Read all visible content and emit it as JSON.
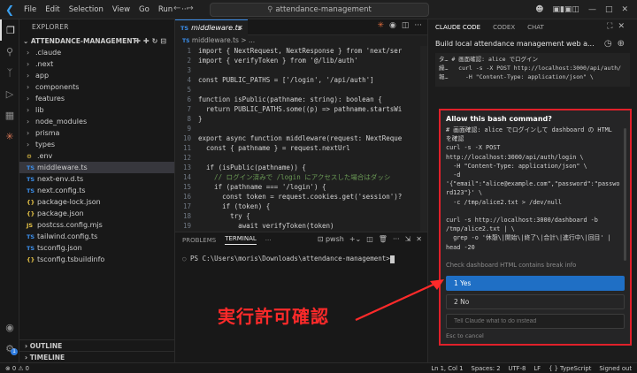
{
  "titlebar": {
    "menus": [
      "File",
      "Edit",
      "Selection",
      "View",
      "Go",
      "Run",
      "···"
    ],
    "search": "attendance-management"
  },
  "sidebar": {
    "header": "EXPLORER",
    "project": "ATTENDANCE-MANAGEMENT",
    "items": [
      {
        "label": ".claude",
        "kind": "folder"
      },
      {
        "label": ".next",
        "kind": "folder"
      },
      {
        "label": "app",
        "kind": "folder"
      },
      {
        "label": "components",
        "kind": "folder"
      },
      {
        "label": "features",
        "kind": "folder"
      },
      {
        "label": "lib",
        "kind": "folder"
      },
      {
        "label": "node_modules",
        "kind": "folder"
      },
      {
        "label": "prisma",
        "kind": "folder"
      },
      {
        "label": "types",
        "kind": "folder"
      },
      {
        "label": ".env",
        "kind": "file",
        "icon": "⚙",
        "color": "#e8c547"
      },
      {
        "label": "middleware.ts",
        "kind": "file",
        "icon": "TS",
        "color": "#3b8eea"
      },
      {
        "label": "next-env.d.ts",
        "kind": "file",
        "icon": "TS",
        "color": "#3b8eea"
      },
      {
        "label": "next.config.ts",
        "kind": "file",
        "icon": "TS",
        "color": "#3b8eea"
      },
      {
        "label": "package-lock.json",
        "kind": "file",
        "icon": "{}",
        "color": "#e8c547"
      },
      {
        "label": "package.json",
        "kind": "file",
        "icon": "{}",
        "color": "#e8c547"
      },
      {
        "label": "postcss.config.mjs",
        "kind": "file",
        "icon": "JS",
        "color": "#e8c547"
      },
      {
        "label": "tailwind.config.ts",
        "kind": "file",
        "icon": "TS",
        "color": "#3b8eea"
      },
      {
        "label": "tsconfig.json",
        "kind": "file",
        "icon": "TS",
        "color": "#3b8eea"
      },
      {
        "label": "tsconfig.tsbuildinfo",
        "kind": "file",
        "icon": "{}",
        "color": "#e8c547"
      }
    ],
    "outline": "OUTLINE",
    "timeline": "TIMELINE"
  },
  "editor": {
    "tab": "middleware.ts",
    "breadcrumb": "middleware.ts > ...",
    "lines": [
      "import { NextRequest, NextResponse } from 'next/ser",
      "import { verifyToken } from '@/lib/auth'",
      "",
      "const PUBLIC_PATHS = ['/login', '/api/auth']",
      "",
      "function isPublic(pathname: string): boolean {",
      "  return PUBLIC_PATHS.some((p) => pathname.startsWi",
      "}",
      "",
      "export async function middleware(request: NextReque",
      "  const { pathname } = request.nextUrl",
      "",
      "  if (isPublic(pathname)) {",
      "    // ログイン済みで /login にアクセスした場合はダッシ",
      "    if (pathname === '/login') {",
      "      const token = request.cookies.get('session')?",
      "      if (token) {",
      "        try {",
      "          await verifyToken(token)",
      "          return NextResponse.redirect(new URL('/da"
    ]
  },
  "panel": {
    "tabs": [
      "PROBLEMS",
      "TERMINAL",
      "···"
    ],
    "shell": "pwsh",
    "prompt": "PS C:\\Users\\moris\\Downloads\\attendance-management>"
  },
  "chat": {
    "tabs": [
      "CLAUDE CODE",
      "CODEX",
      "CHAT"
    ],
    "title": "Build local attendance management web a...",
    "preview": "タ… # 画面確認: alice でログイン\n繰…   curl -s -X POST http://localhost:3000/api/auth/\n報…     -H \"Content-Type: application/json\" \\",
    "dialog": {
      "title": "Allow this bash command?",
      "command": "# 画面確認: alice でログインして dashboard の HTML\nを確認\ncurl -s -X POST\nhttp://localhost:3000/api/auth/login \\\n  -H \"Content-Type: application/json\" \\\n  -d\n'{\"email\":\"alice@example.com\",\"password\":\"passwo\nrd123\"}' \\\n  -c /tmp/alice2.txt > /dev/null\n\ncurl -s http://localhost:3000/dashboard -b\n/tmp/alice2.txt | \\\n  grep -o '休憩\\|開始\\|終了\\|合計\\|進行中\\|回目' |\nhead -20",
      "description": "Check dashboard HTML contains break info",
      "option_yes": "1  Yes",
      "option_no": "2  No",
      "input_placeholder": "Tell Claude what to do instead",
      "esc": "Esc to cancel"
    }
  },
  "annotation": "実行許可確認",
  "status": {
    "left": "⊗ 0 ⚠ 0",
    "items": [
      "Ln 1, Col 1",
      "Spaces: 2",
      "UTF-8",
      "LF",
      "{ } TypeScript",
      "Signed out"
    ]
  }
}
